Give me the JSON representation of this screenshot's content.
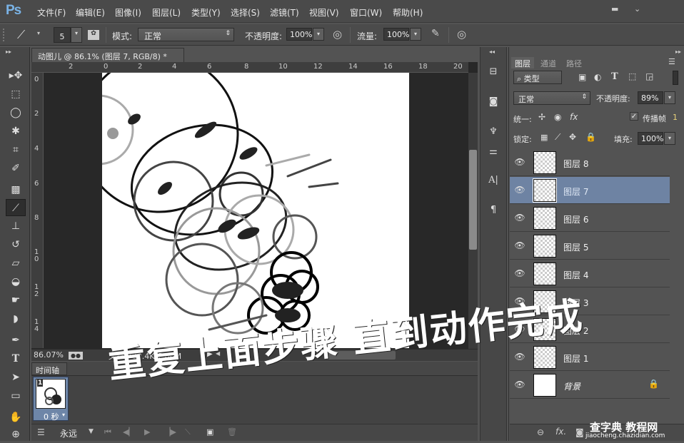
{
  "app": {
    "logo": "Ps"
  },
  "menu": [
    "文件(F)",
    "编辑(E)",
    "图像(I)",
    "图层(L)",
    "类型(Y)",
    "选择(S)",
    "滤镜(T)",
    "视图(V)",
    "窗口(W)",
    "帮助(H)"
  ],
  "options": {
    "brush_size": "5",
    "mode_label": "模式:",
    "mode_value": "正常",
    "opacity_label": "不透明度:",
    "opacity_value": "100%",
    "flow_label": "流量:",
    "flow_value": "100%"
  },
  "document": {
    "tab_title": "动图儿 @ 86.1% (图层 7, RGB/8) *",
    "close": "×",
    "hruler_ticks": [
      "2",
      "0",
      "2",
      "4",
      "6",
      "8",
      "10",
      "12",
      "14",
      "16",
      "18",
      "20"
    ],
    "vruler_ticks": [
      "0",
      "2",
      "4",
      "6",
      "8",
      "10",
      "12",
      "14"
    ],
    "zoom": "86.07%",
    "doc_info": "文档:732.4K/7.06M",
    "scroll_position": 0.28
  },
  "timeline": {
    "tab": "时间轴",
    "frames": [
      {
        "number": "1",
        "delay": "0 秒"
      }
    ],
    "loop": "永远"
  },
  "layers_panel": {
    "tabs": [
      "图层",
      "通道",
      "路径"
    ],
    "filter_kind": "类型",
    "blend_mode": "正常",
    "opacity_label": "不透明度:",
    "opacity_value": "89%",
    "unify_label": "统一:",
    "propagate_label": "传播帧",
    "propagate_value": "1",
    "propagate_checked": true,
    "lock_label": "锁定:",
    "fill_label": "填充:",
    "fill_value": "100%",
    "layers": [
      {
        "name": "图层 8",
        "visible": true,
        "selected": false
      },
      {
        "name": "图层 7",
        "visible": true,
        "selected": true
      },
      {
        "name": "图层 6",
        "visible": true,
        "selected": false
      },
      {
        "name": "图层 5",
        "visible": true,
        "selected": false
      },
      {
        "name": "图层 4",
        "visible": true,
        "selected": false
      },
      {
        "name": "图层 3",
        "visible": true,
        "selected": false
      },
      {
        "name": "图层 2",
        "visible": true,
        "selected": false
      },
      {
        "name": "图层 1",
        "visible": true,
        "selected": false
      },
      {
        "name": "背景",
        "visible": true,
        "selected": false,
        "locked": true
      }
    ]
  },
  "overlay_caption": "重复上面步骤 直到动作完成",
  "watermark": {
    "text": "查字典 教程网",
    "url_text": "jiaocheng.chazidian.com"
  }
}
